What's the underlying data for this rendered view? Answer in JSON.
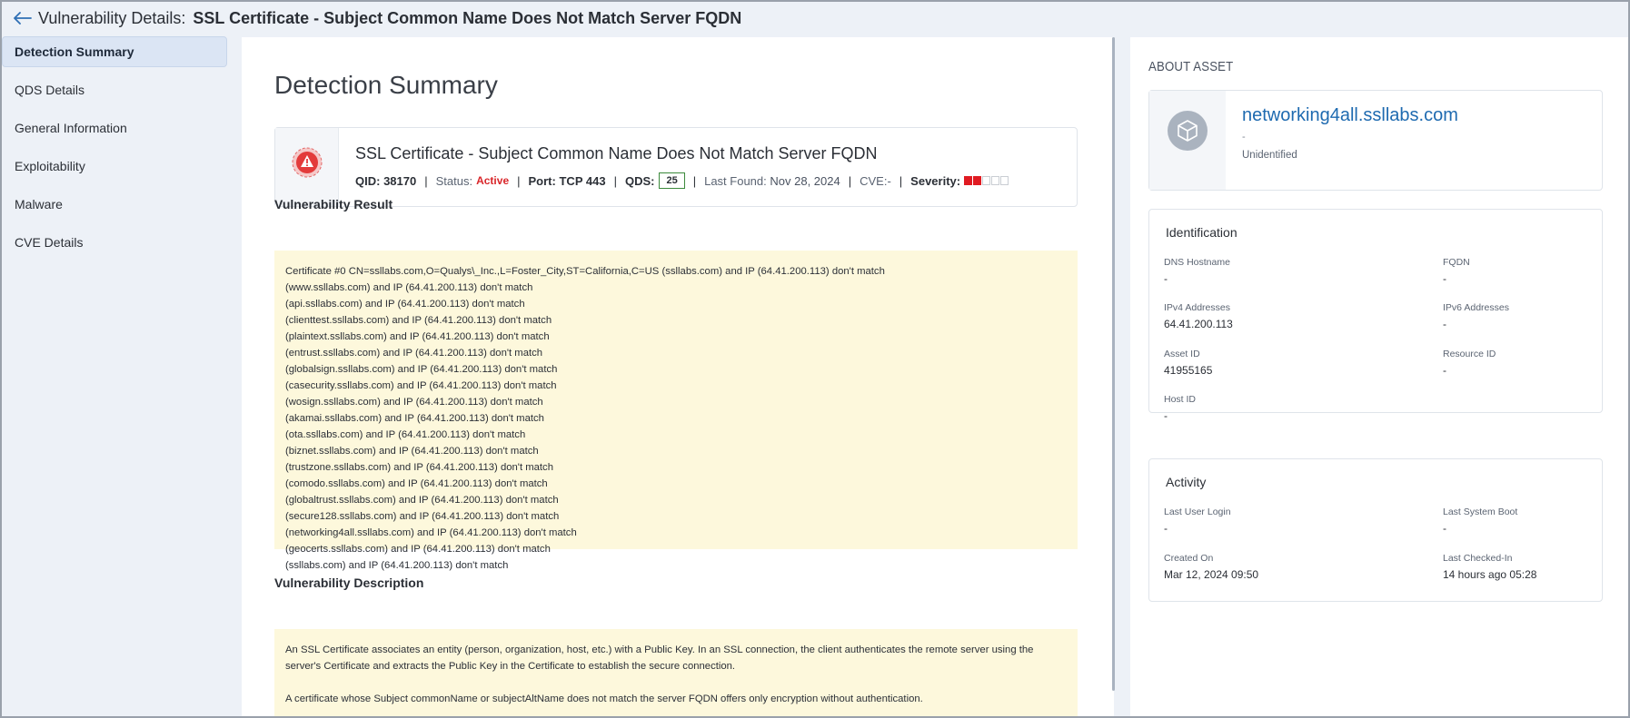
{
  "header": {
    "title_prefix": "Vulnerability Details:",
    "title": "SSL Certificate - Subject Common Name Does Not Match Server FQDN"
  },
  "sidebar": {
    "items": [
      {
        "label": "Detection Summary",
        "active": true
      },
      {
        "label": "QDS Details"
      },
      {
        "label": "General Information"
      },
      {
        "label": "Exploitability"
      },
      {
        "label": "Malware"
      },
      {
        "label": "CVE Details"
      }
    ]
  },
  "main": {
    "heading": "Detection Summary",
    "vuln": {
      "title": "SSL Certificate - Subject Common Name Does Not Match Server FQDN",
      "qid_label": "QID:",
      "qid": "38170",
      "status_label": "Status:",
      "status": "Active",
      "port_label": "Port:",
      "port": "TCP 443",
      "qds_label": "QDS:",
      "qds": "25",
      "last_found_label": "Last Found:",
      "last_found": "Nov 28, 2024",
      "cve_label": "CVE:-",
      "severity_label": "Severity:",
      "severity_level": 2,
      "severity_max": 5,
      "colors": {
        "status": "#d9262a",
        "severity": "#e01b22",
        "qds_border": "#3c8a3c"
      }
    },
    "result_title": "Vulnerability Result",
    "result_lines": [
      "Certificate #0 CN=ssllabs.com,O=Qualys\\_Inc.,L=Foster_City,ST=California,C=US (ssllabs.com) and IP (64.41.200.113) don't match",
      "(www.ssllabs.com) and IP (64.41.200.113) don't match",
      "(api.ssllabs.com) and IP (64.41.200.113) don't match",
      "(clienttest.ssllabs.com) and IP (64.41.200.113) don't match",
      "(plaintext.ssllabs.com) and IP (64.41.200.113) don't match",
      "(entrust.ssllabs.com) and IP (64.41.200.113) don't match",
      "(globalsign.ssllabs.com) and IP (64.41.200.113) don't match",
      "(casecurity.ssllabs.com) and IP (64.41.200.113) don't match",
      "(wosign.ssllabs.com) and IP (64.41.200.113) don't match",
      "(akamai.ssllabs.com) and IP (64.41.200.113) don't match",
      "(ota.ssllabs.com) and IP (64.41.200.113) don't match",
      "(biznet.ssllabs.com) and IP (64.41.200.113) don't match",
      "(trustzone.ssllabs.com) and IP (64.41.200.113) don't match",
      "(comodo.ssllabs.com) and IP (64.41.200.113) don't match",
      "(globaltrust.ssllabs.com) and IP (64.41.200.113) don't match",
      "(secure128.ssllabs.com) and IP (64.41.200.113) don't match",
      "(networking4all.ssllabs.com) and IP (64.41.200.113) don't match",
      "(geocerts.ssllabs.com) and IP (64.41.200.113) don't match",
      "(ssllabs.com) and IP (64.41.200.113) don't match"
    ],
    "description_title": "Vulnerability Description",
    "description_paragraphs": [
      "An SSL Certificate associates an entity (person, organization, host, etc.) with a Public Key. In an SSL connection, the client authenticates the remote server using the server's Certificate and extracts the Public Key in the Certificate to establish the secure connection.",
      "A certificate whose Subject commonName or subjectAltName does not match the server FQDN offers only encryption without authentication."
    ]
  },
  "asset": {
    "section_title": "ABOUT ASSET",
    "name": "networking4all.ssllabs.com",
    "subtitle": "-",
    "type": "Unidentified",
    "identification": {
      "title": "Identification",
      "fields": [
        {
          "label": "DNS Hostname",
          "value": "-"
        },
        {
          "label": "FQDN",
          "value": "-"
        },
        {
          "label": "IPv4 Addresses",
          "value": "64.41.200.113"
        },
        {
          "label": "IPv6 Addresses",
          "value": "-"
        },
        {
          "label": "Asset ID",
          "value": "41955165"
        },
        {
          "label": "Resource ID",
          "value": "-"
        },
        {
          "label": "Host ID",
          "value": "-"
        }
      ]
    },
    "activity": {
      "title": "Activity",
      "fields": [
        {
          "label": "Last User Login",
          "value": "-"
        },
        {
          "label": "Last System Boot",
          "value": "-"
        },
        {
          "label": "Created On",
          "value": "Mar 12, 2024 09:50"
        },
        {
          "label": "Last Checked-In",
          "value": "14 hours ago 05:28"
        }
      ]
    }
  }
}
